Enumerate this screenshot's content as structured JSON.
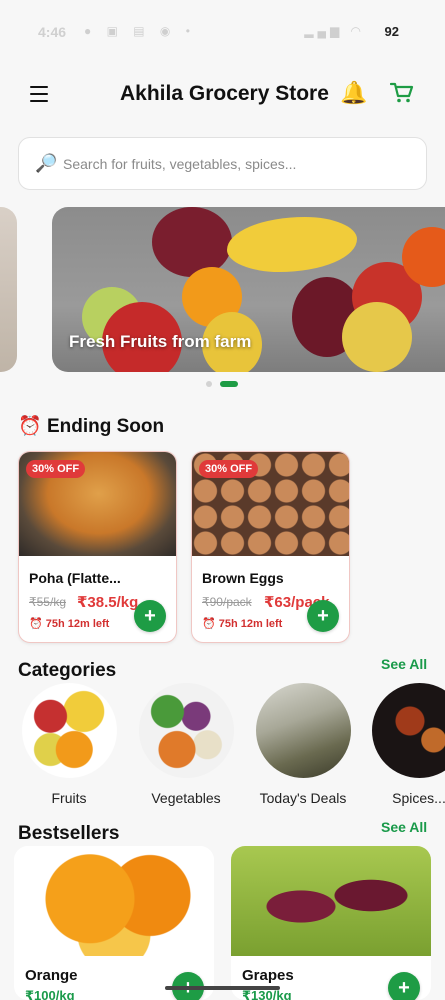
{
  "status_bar": {
    "time": "4:46",
    "battery": "92"
  },
  "header": {
    "title": "Akhila Grocery Store",
    "menu_icon": "hamburger-menu-icon",
    "bell_icon": "bell-icon",
    "cart_icon": "cart-icon"
  },
  "search": {
    "placeholder": "Search for fruits, vegetables, spices...",
    "value": ""
  },
  "banner": {
    "caption": "Fresh Fruits from farm",
    "active_slide": 2,
    "total_slides": 2
  },
  "ending_soon": {
    "title": "Ending Soon",
    "icon": "alarm-clock-icon",
    "items": [
      {
        "badge": "30% OFF",
        "name": "Poha (Flatte...",
        "old_price": "₹55/kg",
        "new_price": "₹38.5/kg",
        "timer": "75h 12m left"
      },
      {
        "badge": "30% OFF",
        "name": "Brown Eggs",
        "old_price": "₹90/pack",
        "new_price": "₹63/pack",
        "timer": "75h 12m left"
      }
    ]
  },
  "categories": {
    "title": "Categories",
    "see_all": "See All",
    "items": [
      {
        "label": "Fruits"
      },
      {
        "label": "Vegetables"
      },
      {
        "label": "Today's Deals"
      },
      {
        "label": "Spices..."
      }
    ]
  },
  "bestsellers": {
    "title": "Bestsellers",
    "see_all": "See All",
    "items": [
      {
        "name": "Orange",
        "price": "₹100/kg"
      },
      {
        "name": "Grapes",
        "price": "₹130/kg"
      }
    ]
  },
  "colors": {
    "accent_green": "#1e9c45",
    "discount_red": "#e03a3a"
  }
}
